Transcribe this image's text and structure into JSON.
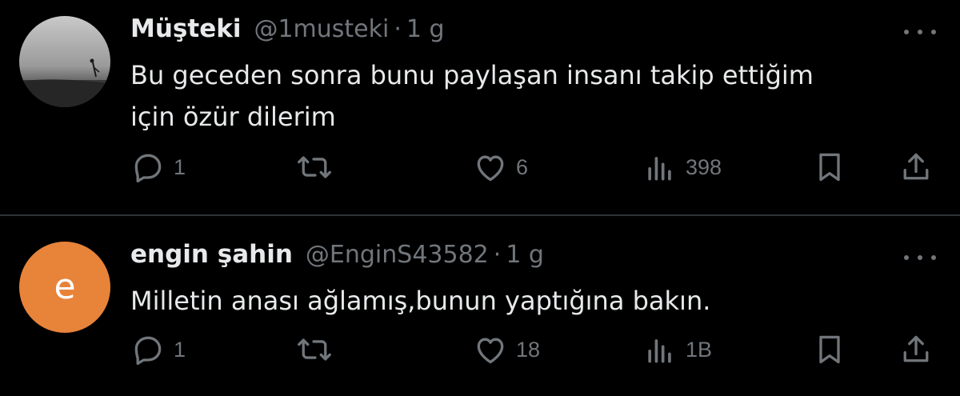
{
  "tweets": [
    {
      "name": "Müşteki",
      "handle": "@1musteki",
      "time": "1 g",
      "text_line1": "Bu geceden sonra bunu paylaşan insanı takip ettiğim",
      "text_line2": "için özür dilerim",
      "replies": "1",
      "likes": "6",
      "views": "398",
      "avatar": "grayscale-photo"
    },
    {
      "name": "engin şahin",
      "handle": "@EnginS43582",
      "time": "1 g",
      "text_line1": "Milletin anası ağlamış,bunun yaptığına bakın.",
      "replies": "1",
      "likes": "18",
      "views": "1B",
      "avatar_letter": "e",
      "avatar_color": "#e8833a"
    }
  ],
  "separator": "·",
  "icons": [
    "more-icon",
    "reply-icon",
    "retweet-icon",
    "like-icon",
    "views-icon",
    "bookmark-icon",
    "share-icon"
  ],
  "colors": {
    "background": "#000000",
    "text": "#e7e9ea",
    "muted": "#71767b",
    "divider": "#2f3336"
  }
}
